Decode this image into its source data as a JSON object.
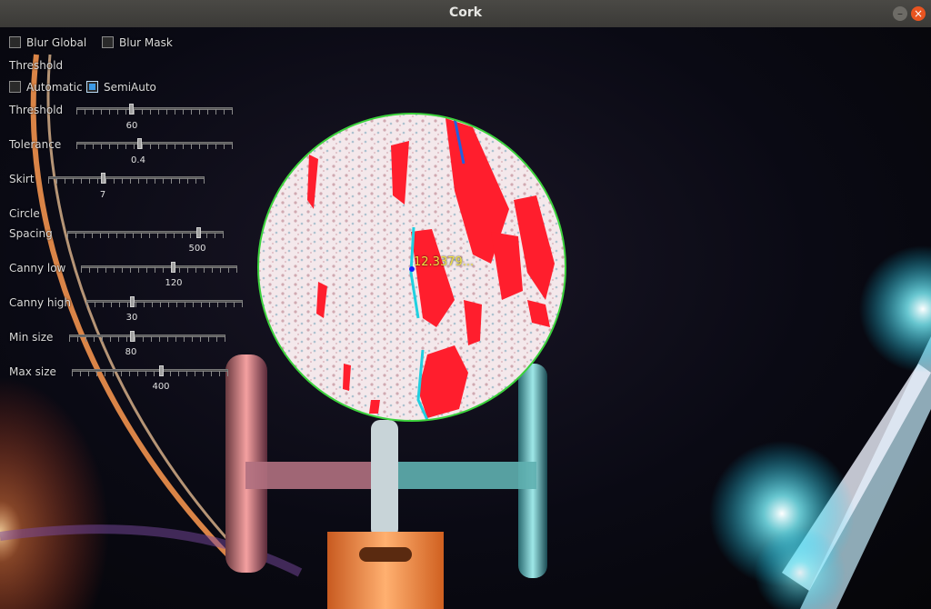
{
  "window": {
    "title": "Cork"
  },
  "controls": {
    "blur_global": {
      "label": "Blur Global",
      "checked": false
    },
    "blur_mask": {
      "label": "Blur Mask",
      "checked": false
    },
    "threshold_heading": "Threshold",
    "automatic": {
      "label": "Automatic",
      "checked": false
    },
    "semiauto": {
      "label": "SemiAuto",
      "checked": true
    },
    "circle_heading": "Circle",
    "sliders": [
      {
        "label": "Threshold",
        "value": "60",
        "fraction": 0.35
      },
      {
        "label": "Tolerance",
        "value": "0.4",
        "fraction": 0.4
      },
      {
        "label": "Skirt",
        "value": "7",
        "fraction": 0.35
      },
      {
        "label": "Spacing",
        "value": "500",
        "fraction": 0.84
      },
      {
        "label": "Canny low",
        "value": "120",
        "fraction": 0.59
      },
      {
        "label": "Canny high",
        "value": "30",
        "fraction": 0.29
      },
      {
        "label": "Min size",
        "value": "80",
        "fraction": 0.4
      },
      {
        "label": "Max size",
        "value": "400",
        "fraction": 0.57
      }
    ]
  },
  "overlay": {
    "measure_text": "12.3379..."
  },
  "colors": {
    "accent": "#3c9ae6",
    "circle": "#3cd23c",
    "defect": "#ff1e2d",
    "measure": "#f0e040"
  }
}
